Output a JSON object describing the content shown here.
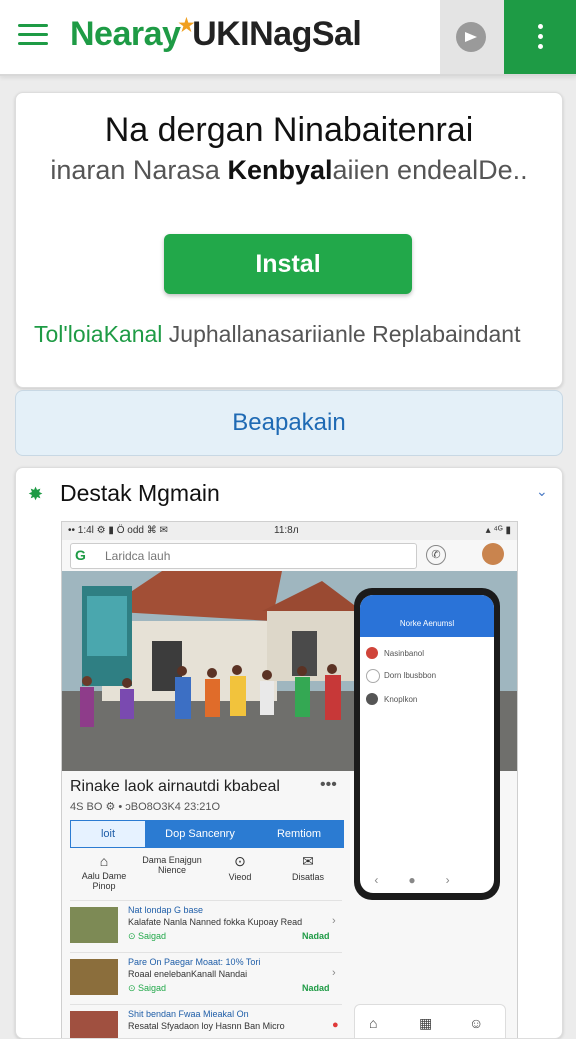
{
  "header": {
    "title_green": "Nearay",
    "title_dark": "UKINagSal",
    "menu_icon": "hamburger-icon",
    "share_icon": "share-icon",
    "more_icon": "more-vertical-icon"
  },
  "promo": {
    "title": "Na dergan Ninabaitenrai",
    "subtitle_pre": "inaran Narasa ",
    "subtitle_bold": "Kenbyal",
    "subtitle_post": "aiien endealDe..",
    "install_label": "Instal",
    "foot_green": "Tol'loiaKanal",
    "foot_rest": " Juphallanasariianle Replabaindant"
  },
  "secondary_button": {
    "label": "Beapakain"
  },
  "feature": {
    "title": "Destak Mgmain",
    "icon": "star-icon",
    "chevron": "chevron-down-icon",
    "screenshot": {
      "status_left": "•• 1:4l ⚙ ▮ Ö odd ⌘ ✉",
      "status_time": "11:8л",
      "status_right": "▴ ⁴ᴳ ▮",
      "search_placeholder": "Laridca lauh",
      "phone_title": "Norke Aenumsl",
      "phone_rows": [
        "Nasinbanol",
        "Dorn lbusbbon",
        "Knoplkon"
      ],
      "caption": "Rinake laok airnautdi kbabeal",
      "meta": "4S BO ⚙ • ɔBO8O3K4 23:21O",
      "tabs": [
        "loit",
        "Dop Sancenry",
        "Remtiom"
      ],
      "icons": [
        {
          "glyph": "⌂",
          "label": "Aalu Dame Pinop"
        },
        {
          "glyph": "",
          "label": "Dama Enajgun Nience"
        },
        {
          "glyph": "⊙",
          "label": "Vieod"
        },
        {
          "glyph": "✉",
          "label": "Disatlas"
        }
      ],
      "items": [
        {
          "t1": "Nat londap G base",
          "t2": "Kalafate Nanla Nanned fokka Kupoay Read",
          "t3": "⊙ Saigad",
          "nd": "Nadad"
        },
        {
          "t1": "Pare On Paegar Moaat: 10% Tori",
          "t2": "Roaal enelebanKanall Nandai",
          "t3": "⊙ Saigad",
          "nd": "Nadad"
        },
        {
          "t1": "Shit bendan Fwaa Mieakal On",
          "t2": "Resatal Sfyadaon loy Hasnn Ban Micro",
          "t3": "",
          "nd": ""
        }
      ]
    }
  }
}
